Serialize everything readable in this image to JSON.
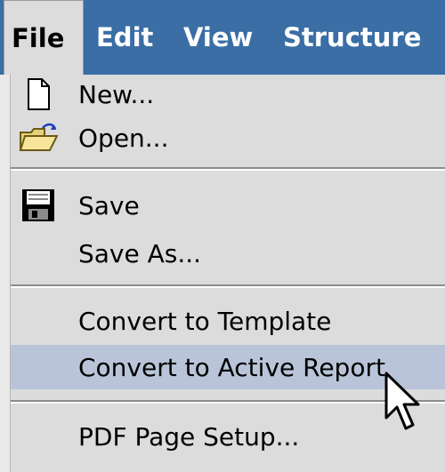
{
  "menubar": {
    "items": [
      {
        "label": "File",
        "active": true
      },
      {
        "label": "Edit",
        "active": false
      },
      {
        "label": "View",
        "active": false
      },
      {
        "label": "Structure",
        "active": false
      }
    ]
  },
  "file_menu": {
    "items": [
      {
        "label": "New...",
        "icon": "new-document-icon"
      },
      {
        "label": "Open...",
        "icon": "open-folder-icon"
      },
      {
        "label": "Save",
        "icon": "save-disk-icon"
      },
      {
        "label": "Save As..."
      },
      {
        "label": "Convert to Template"
      },
      {
        "label": "Convert to Active Report",
        "highlighted": true
      },
      {
        "label": "PDF Page Setup..."
      }
    ]
  },
  "colors": {
    "menubar_bg": "#3a6ea5",
    "menu_bg": "#dcdcdc",
    "highlight": "#b9c4d8"
  }
}
